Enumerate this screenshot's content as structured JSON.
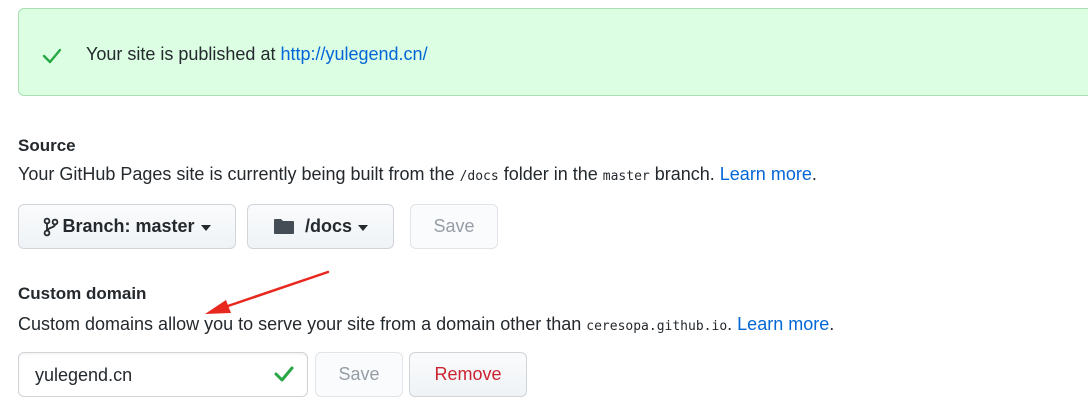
{
  "flash": {
    "text": "Your site is published at ",
    "link": "http://yulegend.cn/",
    "icon": "check-icon",
    "color": "#28a745"
  },
  "source": {
    "title": "Source",
    "desc_1": "Your GitHub Pages site is currently being built from the ",
    "folder_code": "/docs",
    "desc_2": " folder in the ",
    "branch_code": "master",
    "desc_3": " branch. ",
    "learn_more": "Learn more",
    "branch_button": "Branch: master",
    "folder_button": "/docs",
    "save_button": "Save"
  },
  "custom_domain": {
    "title": "Custom domain",
    "desc_1": "Custom domains allow you to serve your site from a domain other than ",
    "domain_code": "ceresopa.github.io",
    "desc_2": ". ",
    "learn_more": "Learn more",
    "input_value": "yulegend.cn",
    "save_button": "Save",
    "remove_button": "Remove"
  },
  "annotation": {
    "arrow_color": "#e8281e"
  }
}
